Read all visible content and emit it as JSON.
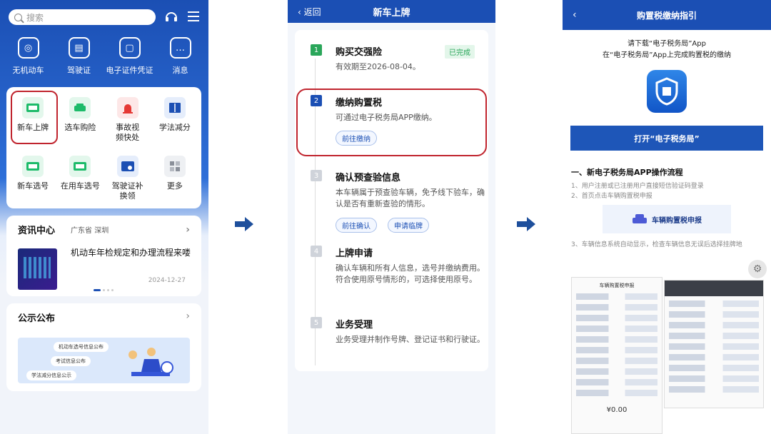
{
  "panel1": {
    "search_placeholder": "搜索",
    "top_items": [
      {
        "label": "无机动车",
        "icon": "car-badge-icon"
      },
      {
        "label": "驾驶证",
        "icon": "license-icon"
      },
      {
        "label": "电子证件凭证",
        "icon": "ecert-icon"
      },
      {
        "label": "消息",
        "icon": "message-icon"
      }
    ],
    "grid_items": [
      {
        "label": "新车上牌",
        "icon": "new-plate-icon",
        "color": "#1dbb6a"
      },
      {
        "label": "选车购险",
        "icon": "car-insurance-icon",
        "color": "#1dbb6a"
      },
      {
        "label": "事故视频快处",
        "icon": "siren-icon",
        "color": "#e53935"
      },
      {
        "label": "学法减分",
        "icon": "book-icon",
        "color": "#1b4fb4"
      },
      {
        "label": "新车选号",
        "icon": "plate-select-icon",
        "color": "#1dbb6a"
      },
      {
        "label": "在用车选号",
        "icon": "plate-select-icon",
        "color": "#1dbb6a"
      },
      {
        "label": "驾驶证补换领",
        "icon": "license-renew-icon",
        "color": "#1b4fb4"
      },
      {
        "label": "更多",
        "icon": "more-grid-icon",
        "color": "#8a8f99"
      }
    ],
    "news": {
      "title": "资讯中心",
      "region": "广东省 深圳",
      "headline": "机动车年检规定和办理流程来喽",
      "date": "2024-12-27"
    },
    "notice": {
      "title": "公示公布",
      "pills": [
        "机动车选号信息公布",
        "考试信息公布",
        "学法减分信息公示"
      ]
    }
  },
  "panel2": {
    "back": "返回",
    "title": "新车上牌",
    "steps": [
      {
        "num": "1",
        "title": "购买交强险",
        "desc": "有效期至2026-08-04。",
        "badge": "已完成"
      },
      {
        "num": "2",
        "title": "缴纳购置税",
        "desc": "可通过电子税务局APP缴纳。",
        "button": "前往缴纳"
      },
      {
        "num": "3",
        "title": "确认预查验信息",
        "desc": "本车辆属于预查验车辆，免予线下验车，确认是否有重新查验的情形。",
        "buttons": [
          "前往确认",
          "申请临牌"
        ]
      },
      {
        "num": "4",
        "title": "上牌申请",
        "desc": "确认车辆和所有人信息，选号并缴纳费用。符合使用原号情形的，可选择使用原号。"
      },
      {
        "num": "5",
        "title": "业务受理",
        "desc": "业务受理并制作号牌、登记证书和行驶证。"
      }
    ]
  },
  "panel3": {
    "title": "购置税缴纳指引",
    "intro1": "请下载“电子税务局”App",
    "intro2": "在“电子税务局”App上完成购置税的缴纳",
    "open_button": "打开“电子税务局”",
    "section": "一、新电子税务局APP操作流程",
    "lines": [
      "1、用户注册或已注册用户直接短信验证码登录",
      "2、首页点击车辆购置税申报"
    ],
    "tax_label": "车辆购置税申报",
    "line3": "3、车辆信息系统自动显示，检查车辆信息无误后选择挂牌地",
    "shot_title": "车辆购置税申报",
    "shot_amount": "¥0.00"
  }
}
